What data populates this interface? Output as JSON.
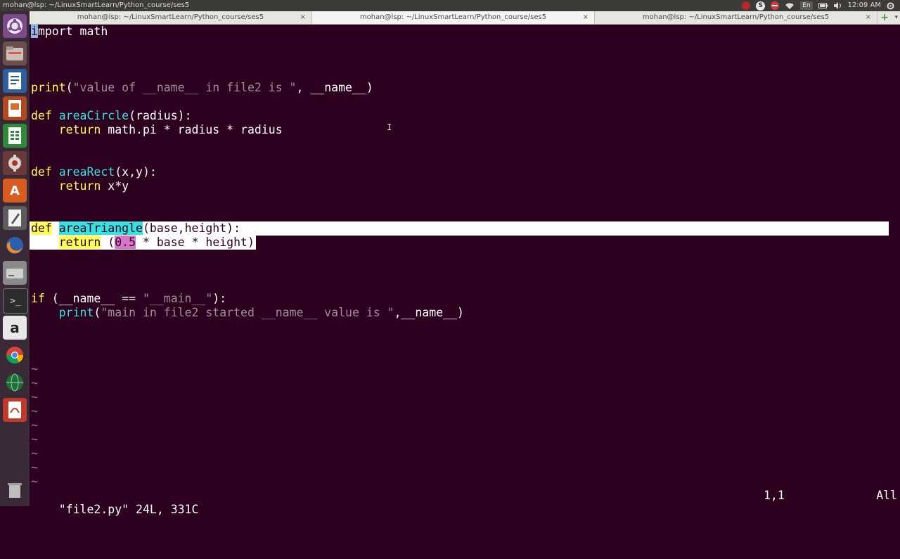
{
  "topbar": {
    "title": "mohan@lsp: ~/LinuxSmartLearn/Python_course/ses5",
    "keyboard": "En",
    "clock": "12:09 AM"
  },
  "launcher": {
    "icons": [
      "dash-icon",
      "files-icon",
      "writer-icon",
      "impress-icon",
      "calc-icon",
      "settings-icon",
      "software-center-icon",
      "text-editor-icon",
      "firefox-icon",
      "disk-icon",
      "terminal-icon",
      "amazon-icon",
      "chrome-icon",
      "globe-icon",
      "document-viewer-icon",
      "trash-icon"
    ]
  },
  "tabs": [
    {
      "label": "mohan@lsp: ~/LinuxSmartLearn/Python_course/ses5",
      "active": false
    },
    {
      "label": "mohan@lsp: ~/LinuxSmartLearn/Python_course/ses5",
      "active": true
    },
    {
      "label": "mohan@lsp: ~/LinuxSmartLearn/Python_course/ses5",
      "active": false
    }
  ],
  "tab_close": "×",
  "code": {
    "l1_cursor": "i",
    "l1_rest": "mport math",
    "l5_print": "print",
    "l5_open": "(",
    "l5_str": "\"value of __name__ in file2 is \"",
    "l5_rest": ", __name__)",
    "l7_def": "def",
    "l7_fn": "areaCircle",
    "l7_rest": "(radius):",
    "l8_return": "return",
    "l8_rest": " math.pi * radius * radius",
    "l11_def": "def",
    "l11_fn": "areaRect",
    "l11_rest": "(x,y):",
    "l12_return": "return",
    "l12_rest": " x*y",
    "l15_def": "def",
    "l15_fn": "areaTriangle",
    "l15_rest": "(base,height):",
    "l16_return": "return",
    "l16_open": " (",
    "l16_num": "0.5",
    "l16_rest": " * base * height)",
    "l20_if": "if",
    "l20_a": " (__name__ == ",
    "l20_str": "\"__main__\"",
    "l20_b": "):",
    "l21_print": "print",
    "l21_open": "(",
    "l21_str": "\"main in file2 started __name__ value is \"",
    "l21_rest": ",__name__)",
    "tilde": "~"
  },
  "status": {
    "file": "\"file2.py\" 24L, 331C",
    "position": "1,1",
    "scroll": "All"
  }
}
